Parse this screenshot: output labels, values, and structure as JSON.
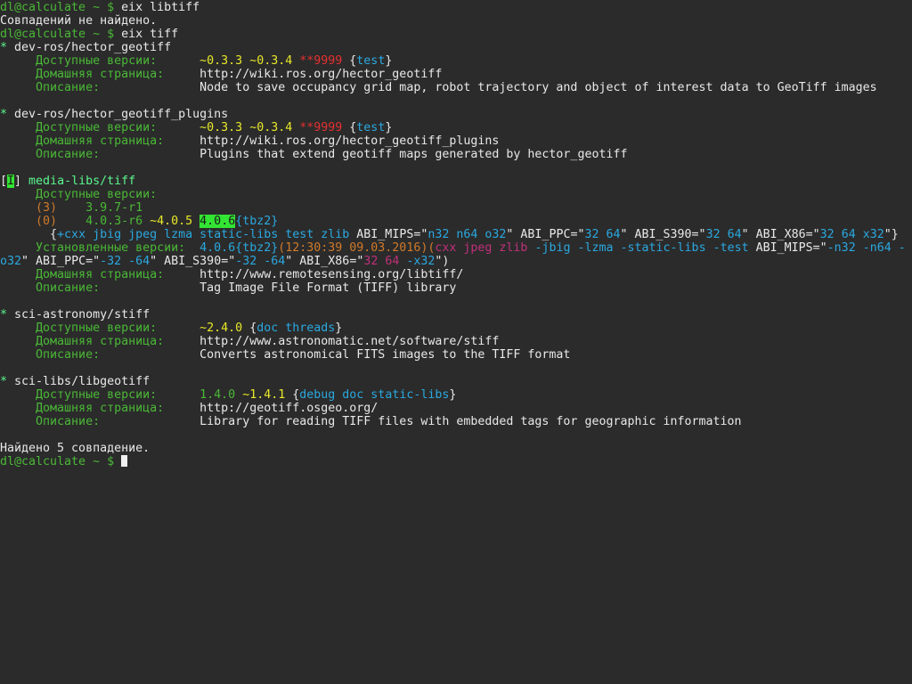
{
  "colors": {
    "background": "#2b2b2b",
    "default": "#e8e8e8",
    "green": "#4ab836",
    "bright_green": "#5af78e",
    "yellow": "#e8e82b",
    "blue": "#2aa8e0",
    "red": "#e63030",
    "orange": "#d07a2a",
    "magenta": "#c0307a",
    "highlight_bg": "#33e533",
    "highlight_fg": "#1a1a1a",
    "cursor": "#f0f0f0"
  },
  "terminal": {
    "lines": [
      [
        {
          "t": "dl@calculate ~ $ ",
          "c": "green"
        },
        {
          "t": "eix libtiff"
        }
      ],
      [
        {
          "t": "Совпадений не найдено."
        }
      ],
      [
        {
          "t": "dl@calculate ~ $ ",
          "c": "green"
        },
        {
          "t": "eix tiff"
        }
      ],
      [
        {
          "t": "*",
          "c": "bright_green"
        },
        {
          "t": " dev-ros/hector_geotiff"
        }
      ],
      [
        {
          "t": "     Доступные версии:      ",
          "c": "green"
        },
        {
          "t": "~0.3.3 ~0.3.4 ",
          "c": "yellow"
        },
        {
          "t": "**9999",
          "c": "red"
        },
        {
          "t": " {"
        },
        {
          "t": "test",
          "c": "blue"
        },
        {
          "t": "}"
        }
      ],
      [
        {
          "t": "     Домашняя страница:     ",
          "c": "green"
        },
        {
          "t": "http://wiki.ros.org/hector_geotiff"
        }
      ],
      [
        {
          "t": "     Описание:              ",
          "c": "green"
        },
        {
          "t": "Node to save occupancy grid map, robot trajectory and object of interest data to GeoTiff images"
        }
      ],
      [],
      [
        {
          "t": "*",
          "c": "bright_green"
        },
        {
          "t": " dev-ros/hector_geotiff_plugins"
        }
      ],
      [
        {
          "t": "     Доступные версии:      ",
          "c": "green"
        },
        {
          "t": "~0.3.3 ~0.3.4 ",
          "c": "yellow"
        },
        {
          "t": "**9999",
          "c": "red"
        },
        {
          "t": " {"
        },
        {
          "t": "test",
          "c": "blue"
        },
        {
          "t": "}"
        }
      ],
      [
        {
          "t": "     Домашняя страница:     ",
          "c": "green"
        },
        {
          "t": "http://wiki.ros.org/hector_geotiff_plugins"
        }
      ],
      [
        {
          "t": "     Описание:              ",
          "c": "green"
        },
        {
          "t": "Plugins that extend geotiff maps generated by hector_geotiff"
        }
      ],
      [],
      [
        {
          "t": "["
        },
        {
          "t": "I",
          "c": "highlight"
        },
        {
          "t": "] "
        },
        {
          "t": "media-libs/tiff",
          "c": "bright_green"
        }
      ],
      [
        {
          "t": "     Доступные версии:",
          "c": "green"
        }
      ],
      [
        {
          "t": "     (3)    ",
          "c": "orange"
        },
        {
          "t": "3.9.7-r1",
          "c": "green"
        }
      ],
      [
        {
          "t": "     (0)    ",
          "c": "orange"
        },
        {
          "t": "4.0.3-r6",
          "c": "green"
        },
        {
          "t": " ~4.0.5 ",
          "c": "yellow"
        },
        {
          "t": "4.0.6",
          "c": "highlight"
        },
        {
          "t": "{tbz2}",
          "c": "blue"
        }
      ],
      [
        {
          "t": "       {"
        },
        {
          "t": "+cxx jbig jpeg lzma static-libs test zlib",
          "c": "blue"
        },
        {
          "t": " ABI_MIPS=\""
        },
        {
          "t": "n32 n64 o32",
          "c": "blue"
        },
        {
          "t": "\" ABI_PPC=\""
        },
        {
          "t": "32 64",
          "c": "blue"
        },
        {
          "t": "\" ABI_S390=\""
        },
        {
          "t": "32 64",
          "c": "blue"
        },
        {
          "t": "\" ABI_X86=\""
        },
        {
          "t": "32 64 x32",
          "c": "blue"
        },
        {
          "t": "\"}"
        }
      ],
      [
        {
          "t": "     Установленные версии:  ",
          "c": "green"
        },
        {
          "t": "4.0.6{tbz2}",
          "c": "blue"
        },
        {
          "t": "(12:30:39 09.03.2016)",
          "c": "orange"
        },
        {
          "t": "(",
          "c": "orange"
        },
        {
          "t": "cxx jpeg zlib",
          "c": "magenta"
        },
        {
          "t": " -jbig -lzma -static-libs -test",
          "c": "blue"
        },
        {
          "t": " ABI_MIPS=\""
        },
        {
          "t": "-n32 -n64 -",
          "c": "blue"
        }
      ],
      [
        {
          "t": "o32",
          "c": "blue"
        },
        {
          "t": "\" ABI_PPC=\""
        },
        {
          "t": "-32 -64",
          "c": "blue"
        },
        {
          "t": "\" ABI_S390=\""
        },
        {
          "t": "-32 -64",
          "c": "blue"
        },
        {
          "t": "\" ABI_X86=\""
        },
        {
          "t": "32 64",
          "c": "magenta"
        },
        {
          "t": " -x32",
          "c": "blue"
        },
        {
          "t": "\")"
        }
      ],
      [
        {
          "t": "     Домашняя страница:     ",
          "c": "green"
        },
        {
          "t": "http://www.remotesensing.org/libtiff/"
        }
      ],
      [
        {
          "t": "     Описание:              ",
          "c": "green"
        },
        {
          "t": "Tag Image File Format (TIFF) library"
        }
      ],
      [],
      [
        {
          "t": "*",
          "c": "bright_green"
        },
        {
          "t": " sci-astronomy/stiff"
        }
      ],
      [
        {
          "t": "     Доступные версии:      ",
          "c": "green"
        },
        {
          "t": "~2.4.0",
          "c": "yellow"
        },
        {
          "t": " {"
        },
        {
          "t": "doc threads",
          "c": "blue"
        },
        {
          "t": "}"
        }
      ],
      [
        {
          "t": "     Домашняя страница:     ",
          "c": "green"
        },
        {
          "t": "http://www.astronomatic.net/software/stiff"
        }
      ],
      [
        {
          "t": "     Описание:              ",
          "c": "green"
        },
        {
          "t": "Converts astronomical FITS images to the TIFF format"
        }
      ],
      [],
      [
        {
          "t": "*",
          "c": "bright_green"
        },
        {
          "t": " sci-libs/libgeotiff"
        }
      ],
      [
        {
          "t": "     Доступные версии:      ",
          "c": "green"
        },
        {
          "t": "1.4.0",
          "c": "green"
        },
        {
          "t": " ~1.4.1",
          "c": "yellow"
        },
        {
          "t": " {"
        },
        {
          "t": "debug doc static-libs",
          "c": "blue"
        },
        {
          "t": "}"
        }
      ],
      [
        {
          "t": "     Домашняя страница:     ",
          "c": "green"
        },
        {
          "t": "http://geotiff.osgeo.org/"
        }
      ],
      [
        {
          "t": "     Описание:              ",
          "c": "green"
        },
        {
          "t": "Library for reading TIFF files with embedded tags for geographic information"
        }
      ],
      [],
      [
        {
          "t": "Найдено 5 совпадение."
        }
      ],
      [
        {
          "t": "dl@calculate ~ $ ",
          "c": "green"
        },
        {
          "cursor": true
        }
      ]
    ]
  }
}
